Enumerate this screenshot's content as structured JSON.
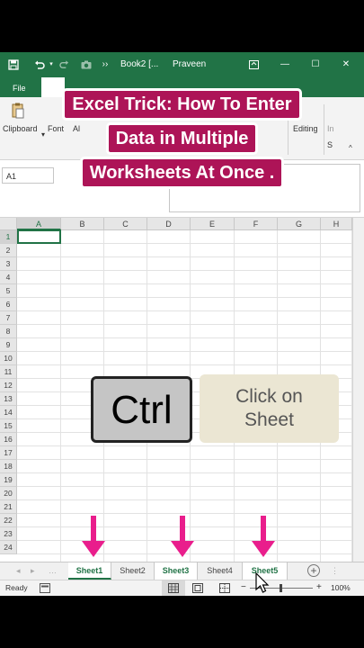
{
  "titlebar": {
    "save_icon": "save-icon",
    "undo_icon": "undo-icon",
    "redo_icon": "redo-icon",
    "camera_icon": "camera-icon",
    "more": "››",
    "doc_title": "Book2 [...",
    "user": "Praveen Sharma",
    "minimize": "—",
    "maximize": "☐",
    "close": "✕"
  },
  "ribbon_tabs": [
    "File",
    ""
  ],
  "ribbon_groups": {
    "clipboard": "Clipboard",
    "font": "Font",
    "alignment": "Al",
    "editing": "Editing",
    "in": "In",
    "s": "S"
  },
  "formula": {
    "name_box": "A1"
  },
  "grid": {
    "columns": [
      "A",
      "B",
      "C",
      "D",
      "E",
      "F",
      "G",
      "H"
    ],
    "rows": [
      "1",
      "2",
      "3",
      "4",
      "5",
      "6",
      "7",
      "8",
      "9",
      "10",
      "11",
      "12",
      "13",
      "14",
      "15",
      "16",
      "17",
      "18",
      "19",
      "20",
      "21",
      "22",
      "23",
      "24"
    ]
  },
  "sheets": [
    "Sheet1",
    "Sheet2",
    "Sheet3",
    "Sheet4",
    "Sheet5"
  ],
  "status": {
    "ready": "Ready",
    "zoom": "100%",
    "minus": "−",
    "plus": "+"
  },
  "overlay": {
    "title_lines": [
      "Excel Trick: How To Enter",
      "Data in Multiple",
      "Worksheets At Once ."
    ],
    "key": "Ctrl",
    "hint_lines": [
      "Click on",
      "Sheet"
    ]
  },
  "colors": {
    "excel_green": "#217346",
    "banner": "#ad1457",
    "arrow": "#e91e8c",
    "key_fill": "#c5c5c5",
    "card_fill": "#ebe6d3"
  }
}
